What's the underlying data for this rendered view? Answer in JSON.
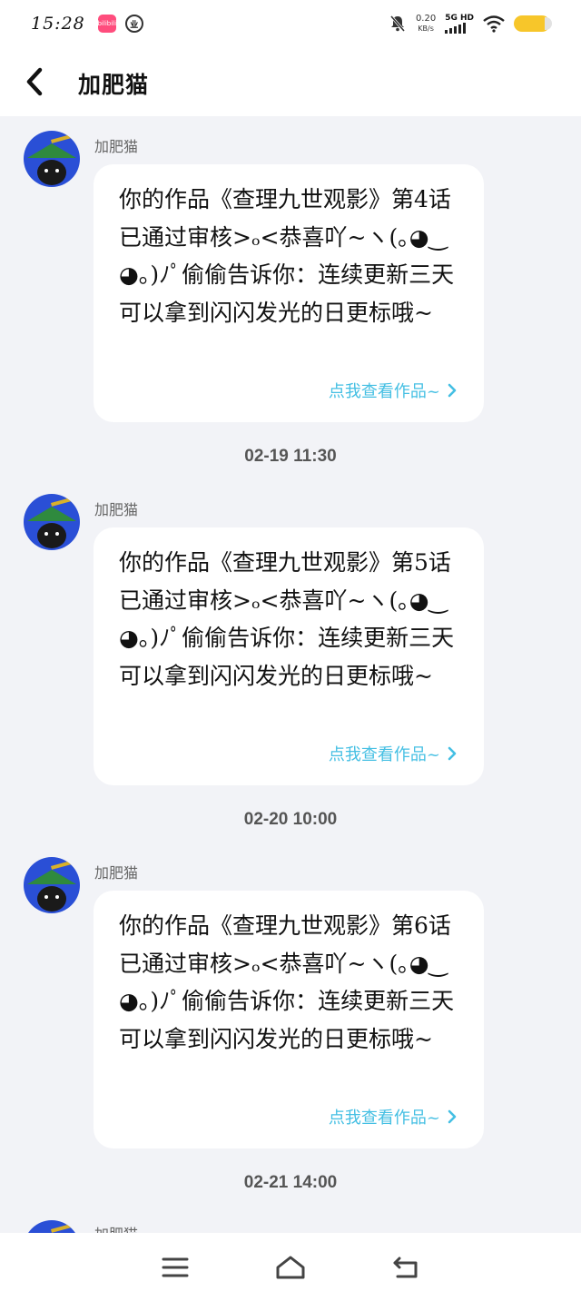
{
  "status_bar": {
    "time": "15:28",
    "app_badge": "bilibili",
    "app_badge2": "业",
    "net_speed": "0.20",
    "net_speed_unit": "KB/s",
    "network": "5G HD"
  },
  "header": {
    "title": "加肥猫"
  },
  "messages": [
    {
      "sender": "加肥猫",
      "text": "你的作品《查理九世观影》第4话已通过审核>ₒ<恭喜吖~ヽ(｡◕‿◕｡)ﾉﾟ偷偷告诉你：连续更新三天可以拿到闪闪发光的日更标哦~",
      "link": "点我查看作品~"
    },
    {
      "sender": "加肥猫",
      "text": "你的作品《查理九世观影》第5话已通过审核>ₒ<恭喜吖~ヽ(｡◕‿◕｡)ﾉﾟ偷偷告诉你：连续更新三天可以拿到闪闪发光的日更标哦~",
      "link": "点我查看作品~"
    },
    {
      "sender": "加肥猫",
      "text": "你的作品《查理九世观影》第6话已通过审核>ₒ<恭喜吖~ヽ(｡◕‿◕｡)ﾉﾟ偷偷告诉你：连续更新三天可以拿到闪闪发光的日更标哦~",
      "link": "点我查看作品~"
    },
    {
      "sender": "加肥猫"
    }
  ],
  "timestamps": [
    "02-19 11:30",
    "02-20 10:00",
    "02-21 14:00"
  ],
  "colors": {
    "background": "#f2f3f7",
    "link": "#44bfe3",
    "avatar": "#2a4fd6",
    "battery": "#f7c62a"
  },
  "nav_bar": {
    "icons": [
      "menu-icon",
      "home-icon",
      "back-return-icon"
    ]
  }
}
